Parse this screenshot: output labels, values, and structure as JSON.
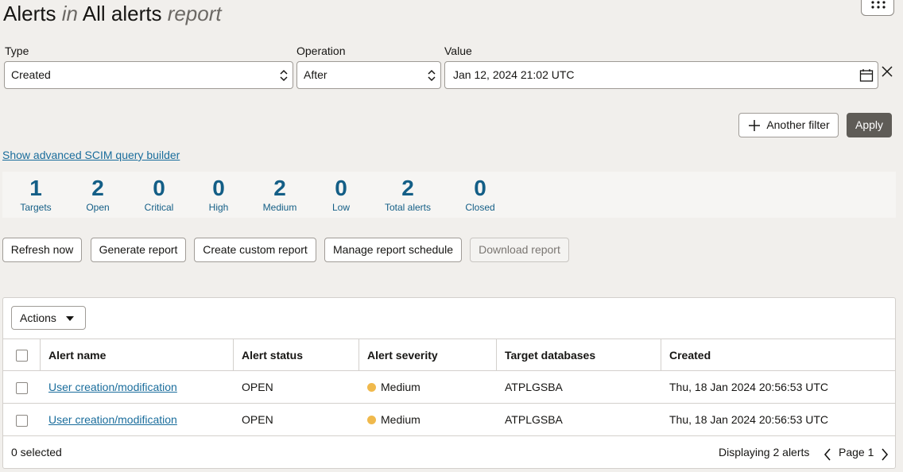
{
  "page": {
    "title_part1": "Alerts",
    "title_in": "in",
    "title_part2": "All alerts",
    "title_report": "report"
  },
  "filters": {
    "type_label": "Type",
    "type_value": "Created",
    "operation_label": "Operation",
    "operation_value": "After",
    "value_label": "Value",
    "value_value": "Jan 12, 2024 21:02 UTC"
  },
  "buttons": {
    "another_filter": "Another filter",
    "apply": "Apply",
    "advanced_link": "Show advanced SCIM query builder",
    "refresh": "Refresh now",
    "generate": "Generate report",
    "create_custom": "Create custom report",
    "manage_schedule": "Manage report schedule",
    "download": "Download report"
  },
  "stats": [
    {
      "value": "1",
      "label": "Targets"
    },
    {
      "value": "2",
      "label": "Open"
    },
    {
      "value": "0",
      "label": "Critical"
    },
    {
      "value": "0",
      "label": "High"
    },
    {
      "value": "2",
      "label": "Medium"
    },
    {
      "value": "0",
      "label": "Low"
    },
    {
      "value": "2",
      "label": "Total alerts"
    },
    {
      "value": "0",
      "label": "Closed"
    }
  ],
  "table": {
    "actions_label": "Actions",
    "columns": [
      "Alert name",
      "Alert status",
      "Alert severity",
      "Target databases",
      "Created"
    ],
    "rows": [
      {
        "name": "User creation/modification",
        "status": "OPEN",
        "severity": "Medium",
        "target": "ATPLGSBA",
        "created": "Thu, 18 Jan 2024 20:56:53 UTC"
      },
      {
        "name": "User creation/modification",
        "status": "OPEN",
        "severity": "Medium",
        "target": "ATPLGSBA",
        "created": "Thu, 18 Jan 2024 20:56:53 UTC"
      }
    ],
    "selected_text": "0 selected",
    "displaying_text": "Displaying 2 alerts",
    "page_text": "Page 1"
  },
  "colors": {
    "accent": "#135e86",
    "link": "#1a6d9c",
    "severity_medium": "#f0b94c"
  }
}
